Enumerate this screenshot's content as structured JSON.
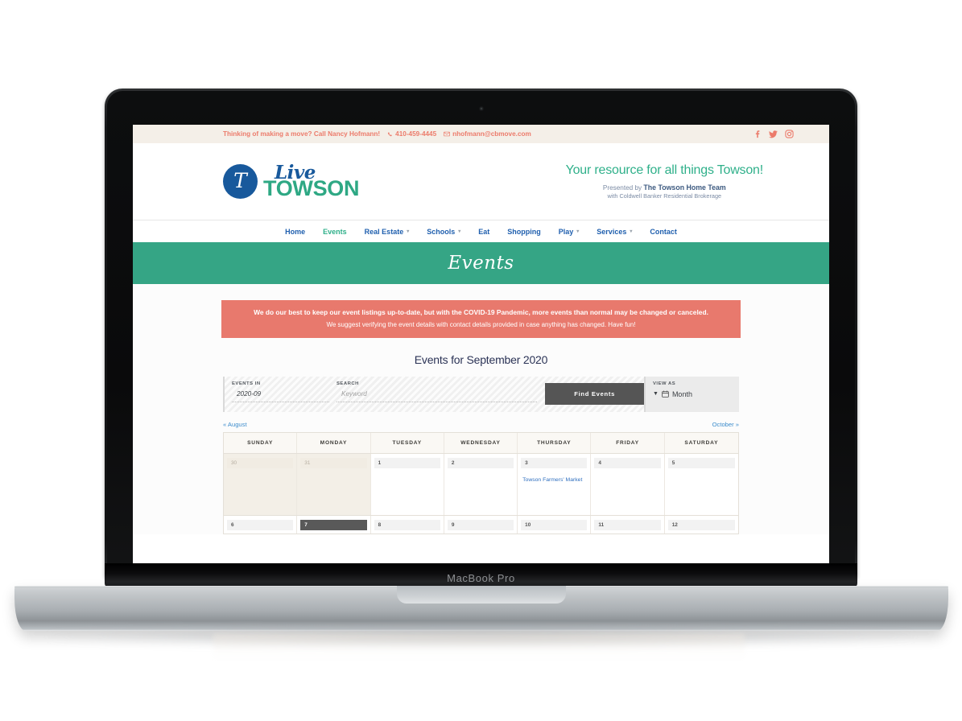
{
  "device": {
    "model_label": "MacBook Pro"
  },
  "site": {
    "topbar": {
      "tagline": "Thinking of making a move? Call Nancy Hofmann!",
      "phone": "410-459-4445",
      "email": "nhofmann@cbmove.com",
      "phone_icon": "phone-icon",
      "email_icon": "envelope-icon",
      "socials": [
        {
          "name": "facebook-icon",
          "glyph": "f"
        },
        {
          "name": "twitter-icon",
          "glyph": "t"
        },
        {
          "name": "instagram-icon",
          "glyph": "i"
        }
      ],
      "bg_color": "#f4efe8",
      "text_color": "#ec7b6b"
    },
    "logo": {
      "monogram": "T",
      "word_script": "Live",
      "word_main": "TOWSON",
      "circle_color": "#18599c",
      "main_color": "#2ea884"
    },
    "tagline_block": {
      "headline": "Your resource for all things Towson!",
      "presented_prefix": "Presented by ",
      "presented_name": "The Towson Home Team",
      "brokerage": "with Coldwell Banker Residential Brokerage",
      "headline_color": "#2fb08a"
    },
    "nav": {
      "items": [
        {
          "label": "Home",
          "has_dropdown": false,
          "active": false
        },
        {
          "label": "Events",
          "has_dropdown": false,
          "active": true
        },
        {
          "label": "Real Estate",
          "has_dropdown": true,
          "active": false
        },
        {
          "label": "Schools",
          "has_dropdown": true,
          "active": false
        },
        {
          "label": "Eat",
          "has_dropdown": false,
          "active": false
        },
        {
          "label": "Shopping",
          "has_dropdown": false,
          "active": false
        },
        {
          "label": "Play",
          "has_dropdown": true,
          "active": false
        },
        {
          "label": "Services",
          "has_dropdown": true,
          "active": false
        },
        {
          "label": "Contact",
          "has_dropdown": false,
          "active": false
        }
      ],
      "link_color": "#1f5fae",
      "active_color": "#2fb08a"
    },
    "page_banner": {
      "title": "Events",
      "bg_color": "#35a585"
    },
    "alert": {
      "line1": "We do our best to keep our event listings up-to-date, but with the COVID-19 Pandemic, more events than normal may be changed or canceled.",
      "line2": "We suggest verifying the event details with contact details provided in case anything has changed. Have fun!",
      "bg_color": "#e8796d"
    },
    "events": {
      "heading": "Events for September 2020",
      "search": {
        "events_in_label": "Events In",
        "events_in_value": "2020-09",
        "search_label": "Search",
        "search_placeholder": "Keyword",
        "search_value": "",
        "find_button": "Find Events",
        "view_as_label": "View As",
        "view_as_value": "Month",
        "view_as_icon": "calendar-icon",
        "caret_icon": "caret-down-icon"
      },
      "month_nav": {
        "prev": "« August",
        "next": "October »"
      },
      "calendar": {
        "day_headers": [
          "Sunday",
          "Monday",
          "Tuesday",
          "Wednesday",
          "Thursday",
          "Friday",
          "Saturday"
        ],
        "weeks": [
          {
            "days": [
              {
                "num": "30",
                "other_month": true,
                "today": false,
                "events": []
              },
              {
                "num": "31",
                "other_month": true,
                "today": false,
                "events": []
              },
              {
                "num": "1",
                "other_month": false,
                "today": false,
                "events": []
              },
              {
                "num": "2",
                "other_month": false,
                "today": false,
                "events": []
              },
              {
                "num": "3",
                "other_month": false,
                "today": false,
                "events": [
                  "Towson Farmers' Market"
                ]
              },
              {
                "num": "4",
                "other_month": false,
                "today": false,
                "events": []
              },
              {
                "num": "5",
                "other_month": false,
                "today": false,
                "events": []
              }
            ]
          },
          {
            "days": [
              {
                "num": "6",
                "other_month": false,
                "today": false,
                "events": []
              },
              {
                "num": "7",
                "other_month": false,
                "today": true,
                "events": []
              },
              {
                "num": "8",
                "other_month": false,
                "today": false,
                "events": []
              },
              {
                "num": "9",
                "other_month": false,
                "today": false,
                "events": []
              },
              {
                "num": "10",
                "other_month": false,
                "today": false,
                "events": []
              },
              {
                "num": "11",
                "other_month": false,
                "today": false,
                "events": []
              },
              {
                "num": "12",
                "other_month": false,
                "today": false,
                "events": []
              }
            ]
          }
        ]
      }
    }
  }
}
